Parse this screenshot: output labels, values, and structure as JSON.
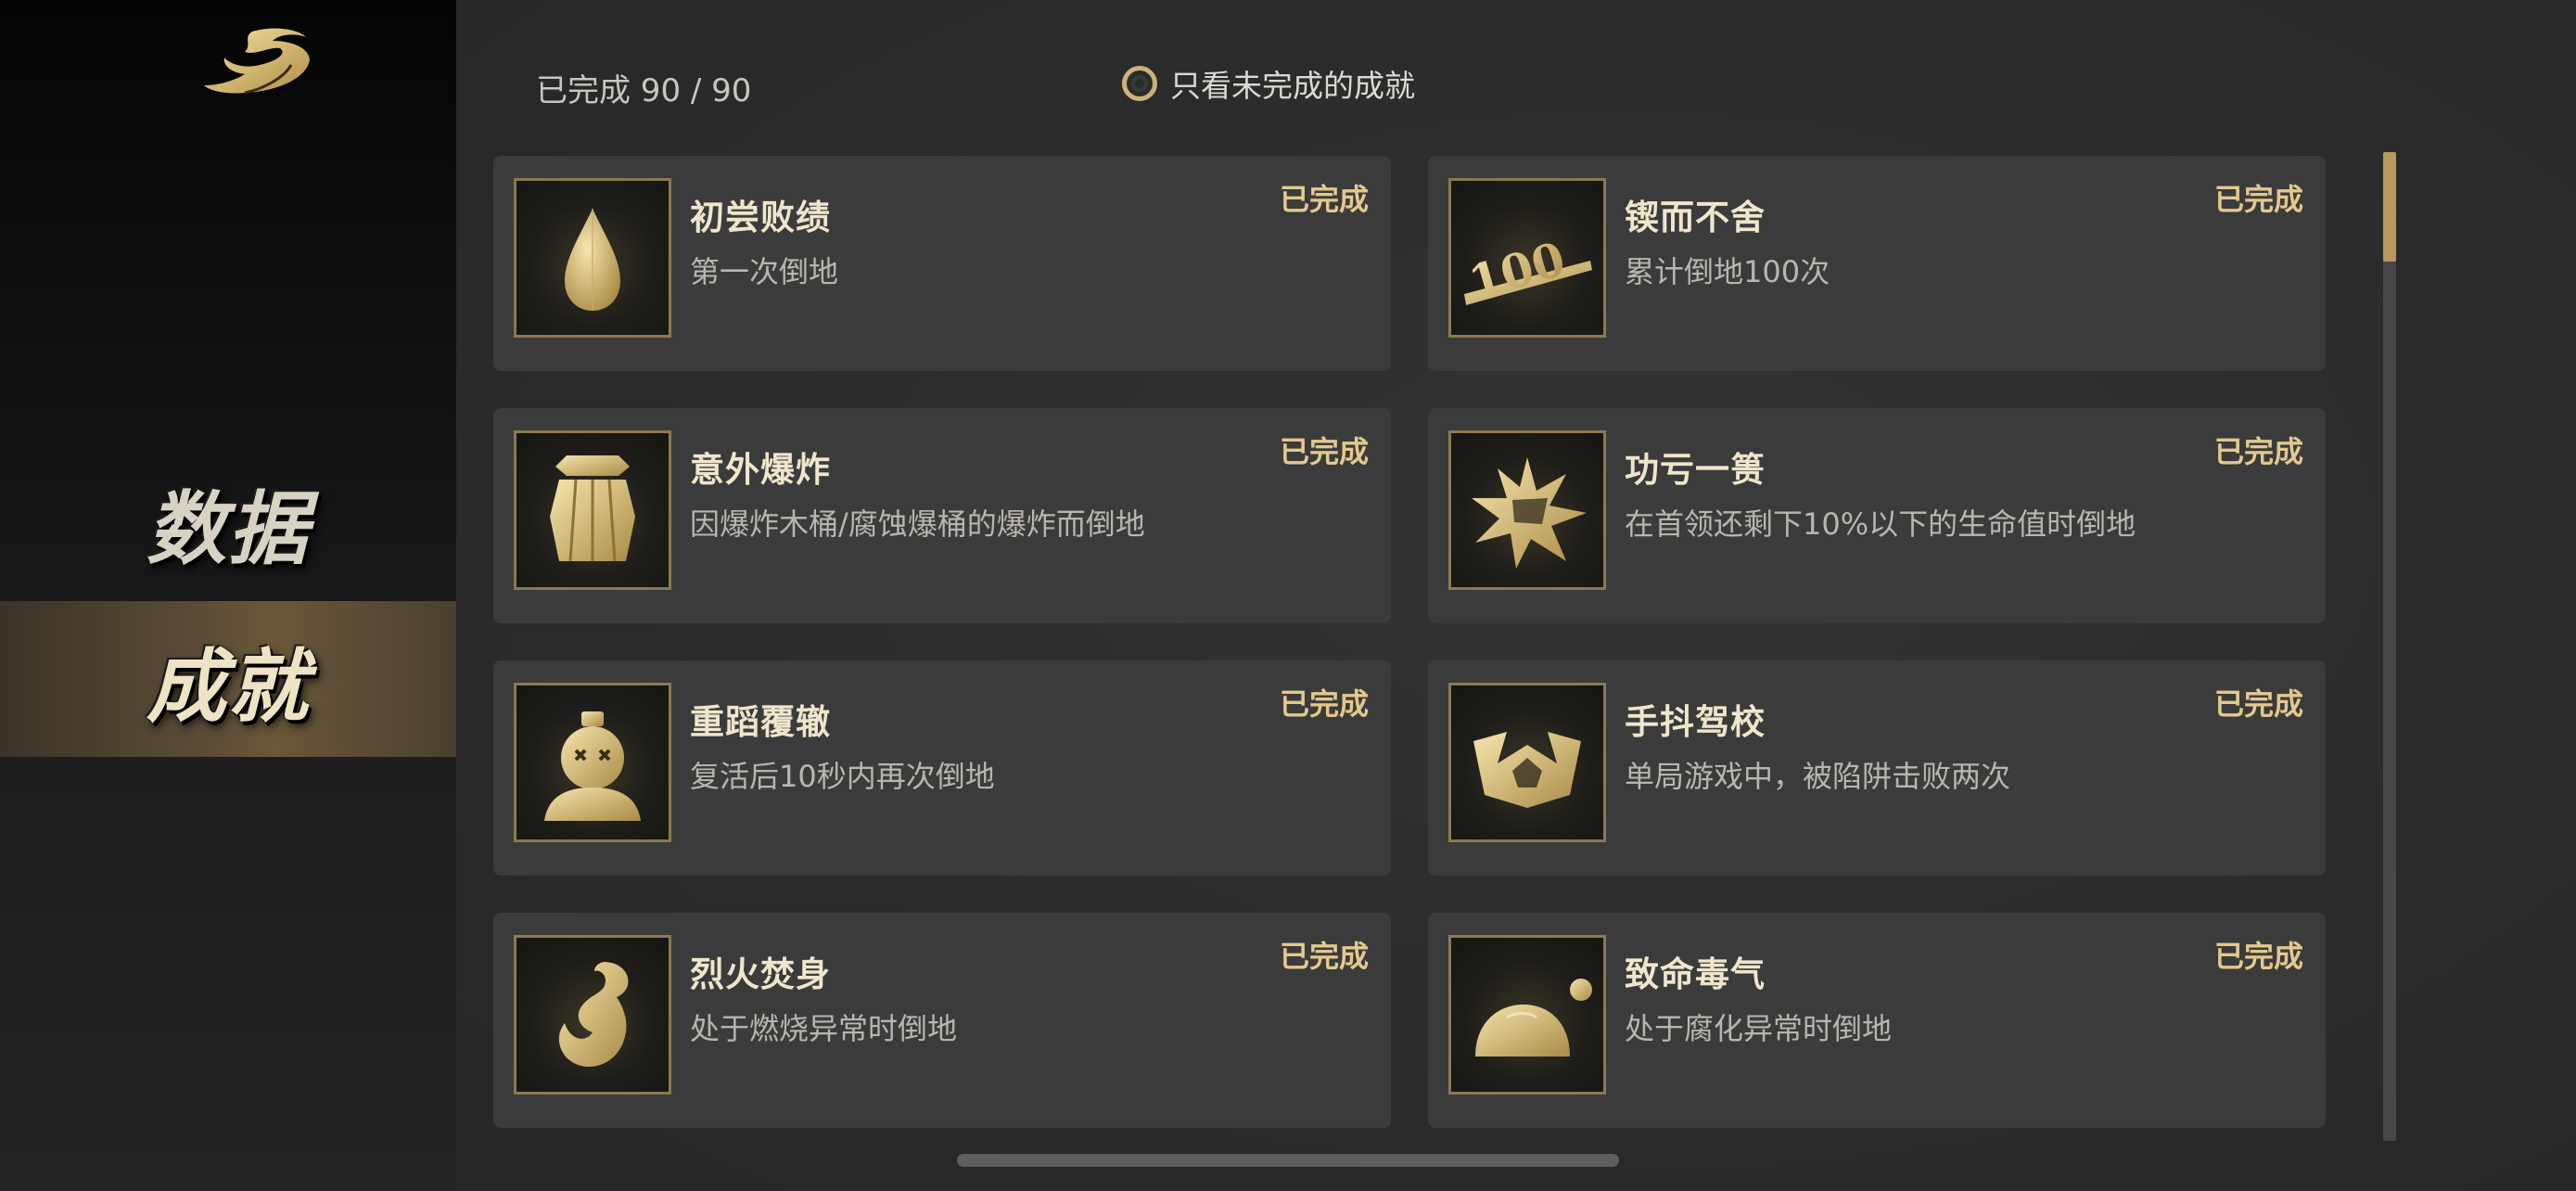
{
  "sidebar": {
    "logo_icon": "dragon-emblem-icon",
    "items": [
      {
        "label": "数据",
        "active": false
      },
      {
        "label": "成就",
        "active": true
      }
    ]
  },
  "header": {
    "progress_text": "已完成 90 / 90",
    "filter_label": "只看未完成的成就",
    "filter_checked": false
  },
  "achievements": [
    {
      "title": "初尝败绩",
      "desc": "第一次倒地",
      "status": "已完成",
      "icon": "droplet-icon"
    },
    {
      "title": "锲而不舍",
      "desc": "累计倒地100次",
      "status": "已完成",
      "icon": "hundred-icon",
      "icon_text": "100"
    },
    {
      "title": "意外爆炸",
      "desc": "因爆炸木桶/腐蚀爆桶的爆炸而倒地",
      "status": "已完成",
      "icon": "barrel-icon"
    },
    {
      "title": "功亏一篑",
      "desc": "在首领还剩下10%以下的生命值时倒地",
      "status": "已完成",
      "icon": "burst-icon"
    },
    {
      "title": "重蹈覆辙",
      "desc": "复活后10秒内再次倒地",
      "status": "已完成",
      "icon": "dead-bust-icon"
    },
    {
      "title": "手抖驾校",
      "desc": "单局游戏中，被陷阱击败两次",
      "status": "已完成",
      "icon": "trap-icon"
    },
    {
      "title": "烈火焚身",
      "desc": "处于燃烧异常时倒地",
      "status": "已完成",
      "icon": "flame-icon"
    },
    {
      "title": "致命毒气",
      "desc": "处于腐化异常时倒地",
      "status": "已完成",
      "icon": "poison-dome-icon"
    }
  ],
  "colors": {
    "accent_gold": "#e3c98e",
    "card_bg": "#3b3b3b",
    "active_tab": "#6a573a"
  }
}
